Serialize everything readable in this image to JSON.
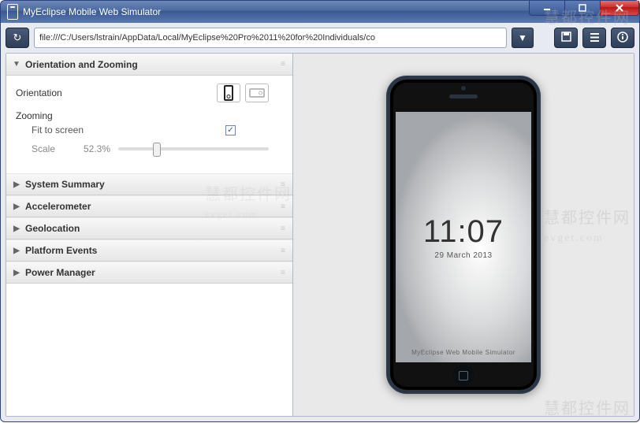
{
  "window": {
    "title": "MyEclipse Mobile Web Simulator"
  },
  "toolbar": {
    "url": "file:///C:/Users/lstrain/AppData/Local/MyEclipse%20Pro%2011%20for%20Individuals/co"
  },
  "panels": {
    "orientation_zoom": {
      "title": "Orientation and Zooming",
      "orientation_label": "Orientation",
      "zooming_label": "Zooming",
      "fit_label": "Fit to screen",
      "fit_checked": true,
      "scale_label": "Scale",
      "scale_value": "52.3%",
      "slider_percent": 23
    },
    "collapsed": [
      "System Summary",
      "Accelerometer",
      "Geolocation",
      "Platform Events",
      "Power Manager"
    ]
  },
  "device": {
    "time": "11:07",
    "date": "29 March 2013",
    "footer": "MyEclipse Web Mobile Simulator"
  },
  "watermarks": {
    "cn": "慧都控件网",
    "url": "evget.com"
  }
}
